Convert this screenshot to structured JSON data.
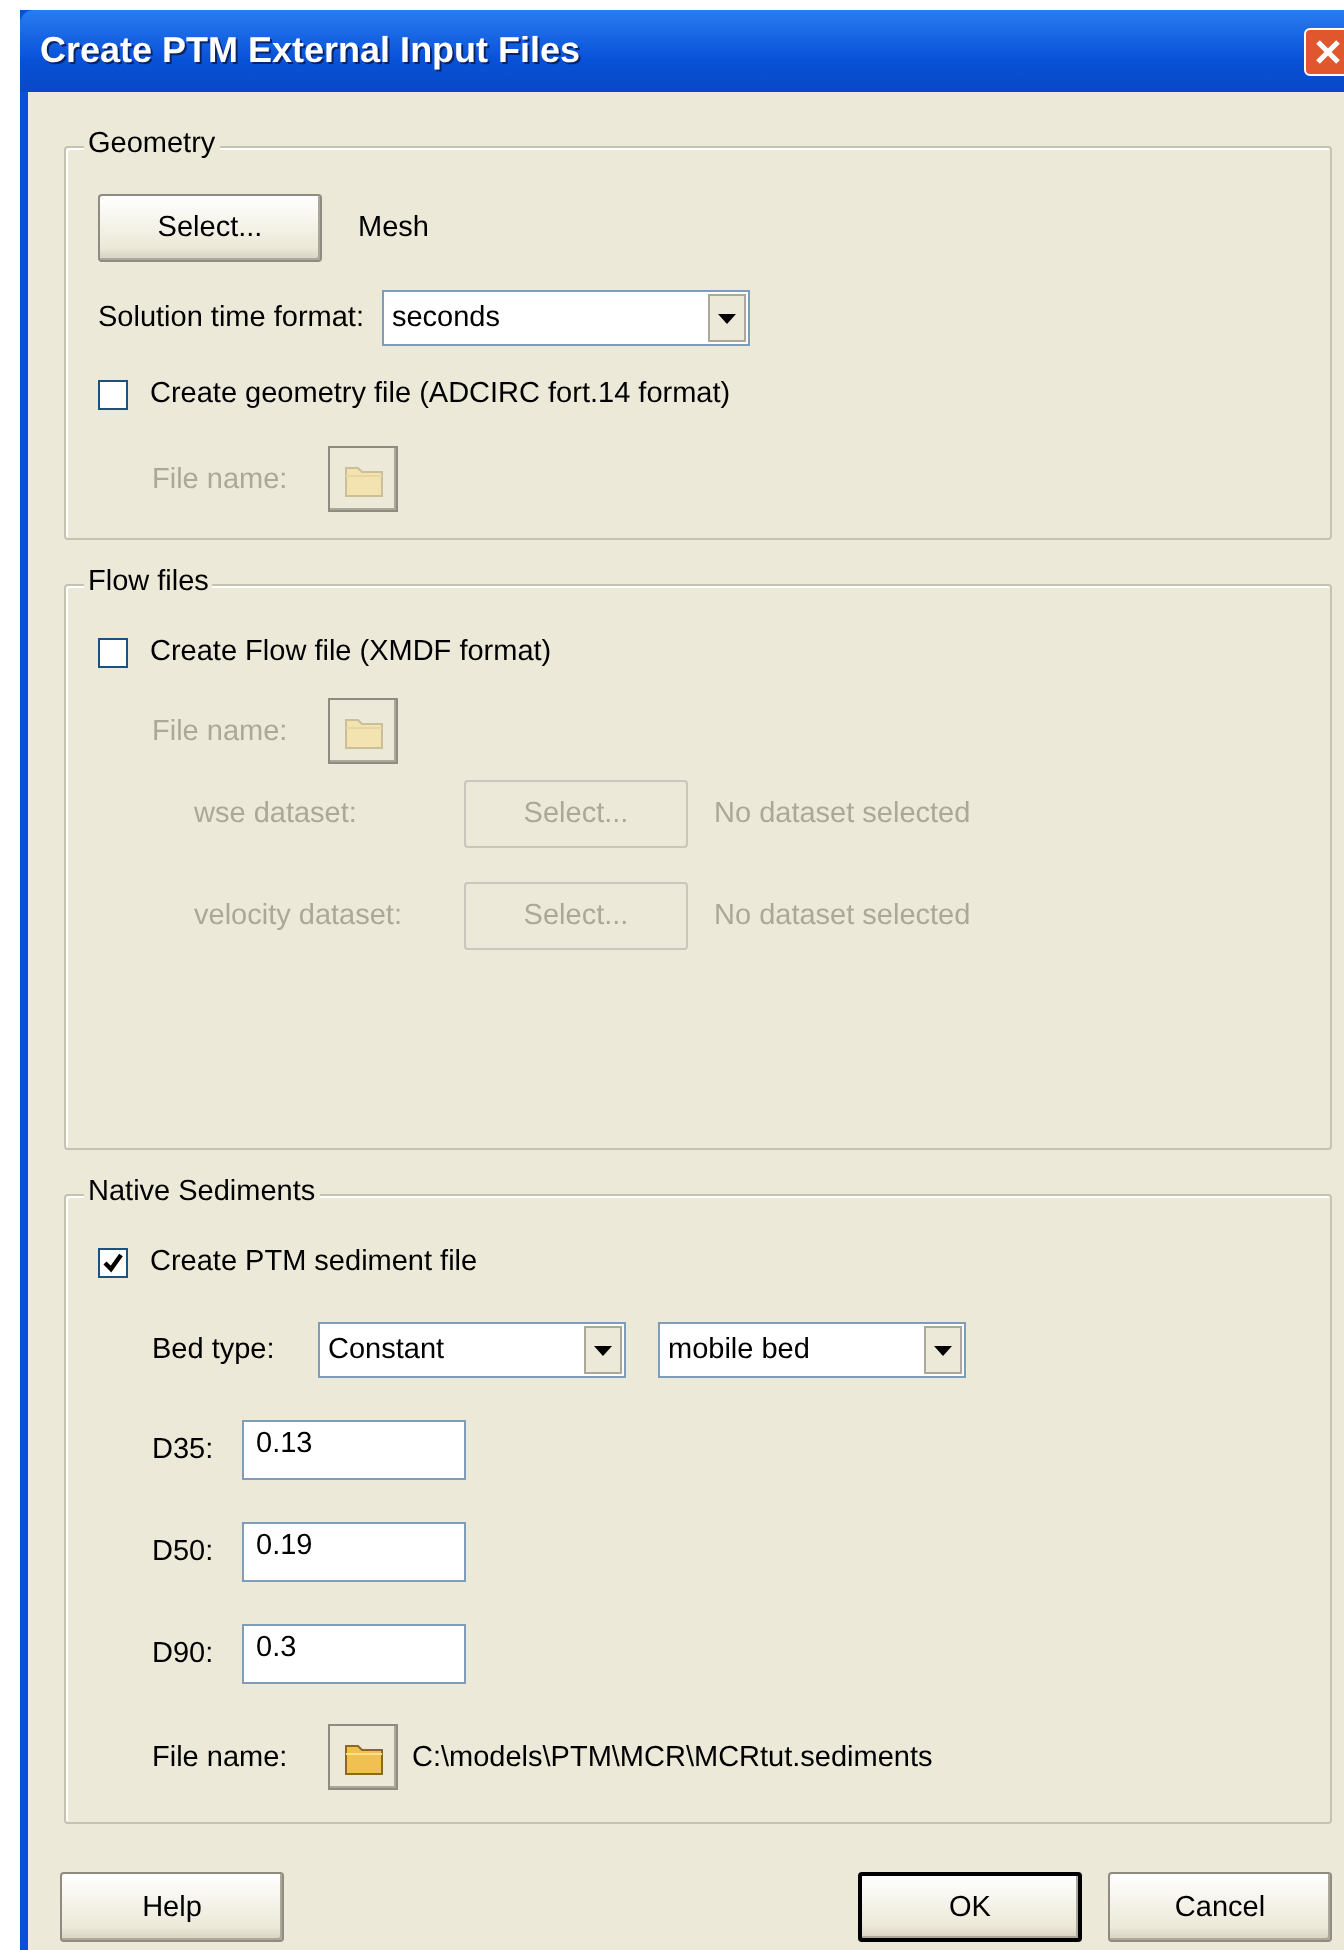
{
  "window": {
    "title": "Create PTM External Input Files"
  },
  "geometry": {
    "legend": "Geometry",
    "select_button": {
      "label": "Select..."
    },
    "selection": "Mesh",
    "time_format": {
      "label": "Solution time format:",
      "value": "seconds"
    },
    "create_file": {
      "label": "Create geometry file (ADCIRC fort.14 format)",
      "checked": false
    },
    "file_name": {
      "label": "File name:",
      "disabled": true
    }
  },
  "flow_files": {
    "legend": "Flow files",
    "create_file": {
      "label": "Create Flow file (XMDF format)",
      "checked": false
    },
    "file_name": {
      "label": "File name:",
      "disabled": true
    },
    "datasets": [
      {
        "label": "wse dataset:",
        "button": "Select...",
        "status": "No dataset selected",
        "disabled": true
      },
      {
        "label": "velocity dataset:",
        "button": "Select...",
        "status": "No dataset selected",
        "disabled": true
      }
    ]
  },
  "native_sediments": {
    "legend": "Native Sediments",
    "create_file": {
      "label": "Create PTM sediment file",
      "checked": true
    },
    "bed_type": {
      "label": "Bed type:",
      "values": [
        "Constant",
        "mobile bed"
      ]
    },
    "fields": [
      {
        "label": "D35:",
        "value": "0.13"
      },
      {
        "label": "D50:",
        "value": "0.19"
      },
      {
        "label": "D90:",
        "value": "0.3"
      }
    ],
    "file_name": {
      "label": "File name:",
      "disabled": false,
      "path": "C:\\models\\PTM\\MCR\\MCRtut.sediments"
    }
  },
  "buttons": [
    {
      "label": "Help",
      "default": false
    },
    {
      "label": "OK",
      "default": true
    },
    {
      "label": "Cancel",
      "default": false
    }
  ]
}
